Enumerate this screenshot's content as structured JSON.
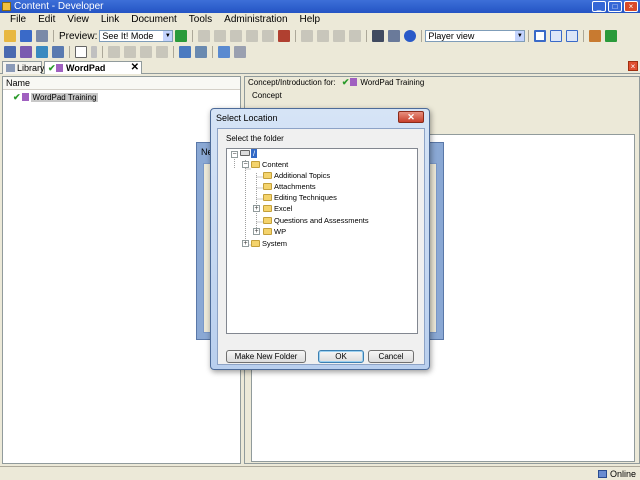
{
  "window": {
    "title": "Content - Developer"
  },
  "menu": [
    "File",
    "Edit",
    "View",
    "Link",
    "Document",
    "Tools",
    "Administration",
    "Help"
  ],
  "toolbar": {
    "preview_label": "Preview:",
    "preview_mode": "See It! Mode",
    "view_mode": "Player view"
  },
  "tabs": [
    {
      "label": "Library",
      "active": false
    },
    {
      "label": "WordPad Training",
      "active": true
    }
  ],
  "left_panel": {
    "column_header": "Name",
    "selected_document": "WordPad Training"
  },
  "right_panel": {
    "header_prefix": "Concept/Introduction for:",
    "document_name": "WordPad Training",
    "concept_label": "Concept"
  },
  "background_dialog": {
    "title_fragment": "Ne"
  },
  "dialog": {
    "title": "Select Location",
    "label": "Select the folder",
    "root": "/",
    "tree": {
      "content": "Content",
      "children": [
        "Additional Topics",
        "Attachments",
        "Editing Techniques",
        "Excel",
        "Questions and Assessments",
        "WP"
      ],
      "system": "System"
    },
    "buttons": {
      "new_folder": "Make New Folder",
      "ok": "OK",
      "cancel": "Cancel"
    }
  },
  "status": {
    "connection": "Online"
  },
  "colors": {
    "titlebar": "#2454c4",
    "selection": "#3169c6",
    "folder": "#f4d36c"
  }
}
